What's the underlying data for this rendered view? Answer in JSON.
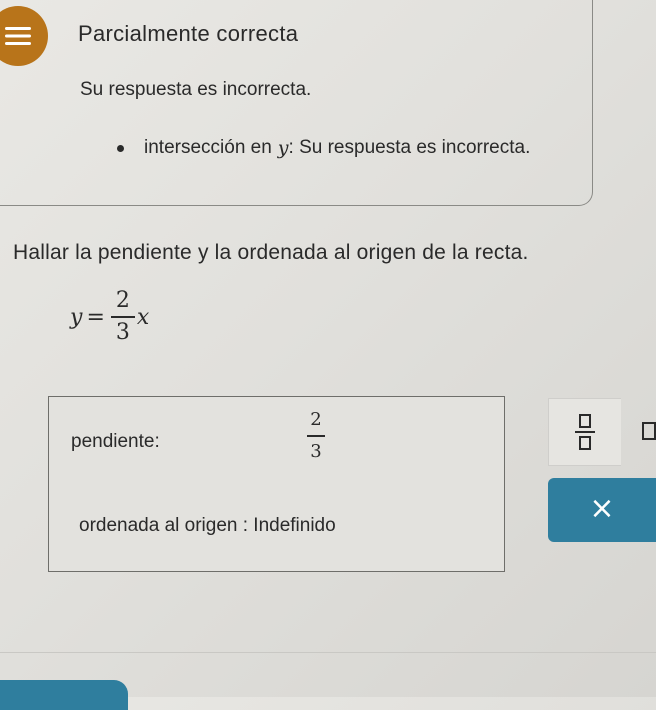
{
  "feedback": {
    "icon": "feedback-lines-icon",
    "icon_color": "#b8741a",
    "title": "Parcialmente correcta",
    "message": "Su respuesta es incorrecta.",
    "items": [
      {
        "prefix": "intersección en",
        "variable": "y",
        "suffix": ": Su respuesta es incorrecta."
      }
    ]
  },
  "question": {
    "text": "Hallar la pendiente y la ordenada al origen de la recta.",
    "equation": {
      "lhs": "y",
      "equals": "=",
      "numerator": "2",
      "denominator": "3",
      "variable": "x"
    }
  },
  "answer": {
    "slope_label": "pendiente:",
    "slope_numerator": "2",
    "slope_denominator": "3",
    "intercept_label": "ordenada al origen : Indefinido"
  },
  "toolbar": {
    "fraction_tool_icon": "fraction-template-icon",
    "box_tool_icon": "empty-box-icon",
    "clear_symbol": "×",
    "accent_color": "#2f7e9e"
  }
}
